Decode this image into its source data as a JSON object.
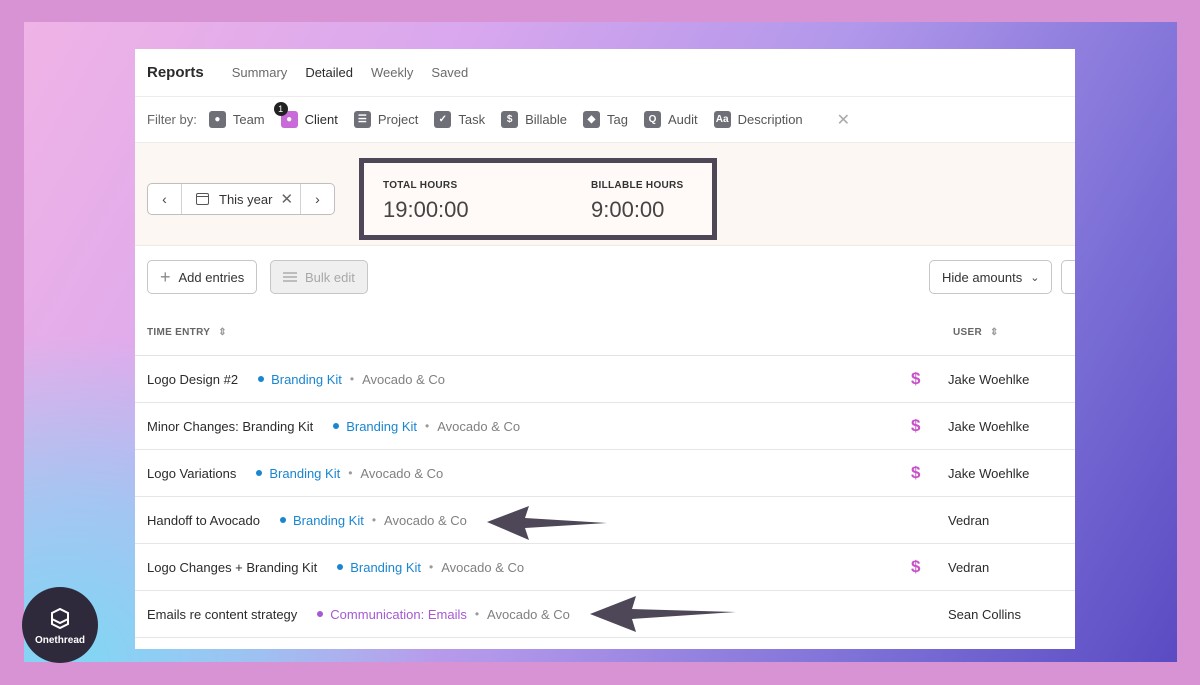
{
  "tabs": {
    "title": "Reports",
    "items": [
      "Summary",
      "Detailed",
      "Weekly",
      "Saved"
    ],
    "active": "Detailed"
  },
  "filters": {
    "label": "Filter by:",
    "items": [
      {
        "label": "Team",
        "icon": "team-icon"
      },
      {
        "label": "Client",
        "icon": "client-icon",
        "badge": "1"
      },
      {
        "label": "Project",
        "icon": "project-icon"
      },
      {
        "label": "Task",
        "icon": "task-icon"
      },
      {
        "label": "Billable",
        "icon": "billable-icon"
      },
      {
        "label": "Tag",
        "icon": "tag-icon"
      },
      {
        "label": "Audit",
        "icon": "audit-icon"
      },
      {
        "label": "Description",
        "icon": "description-icon"
      }
    ]
  },
  "date_picker": {
    "value": "This year"
  },
  "totals": {
    "total_label": "TOTAL HOURS",
    "total_value": "19:00:00",
    "billable_label": "BILLABLE HOURS",
    "billable_value": "9:00:00"
  },
  "toolbar": {
    "add_label": "Add entries",
    "bulk_label": "Bulk edit",
    "hide_label": "Hide amounts"
  },
  "table": {
    "col_entry": "TIME ENTRY",
    "col_user": "USER",
    "rows": [
      {
        "desc": "Logo Design #2",
        "project": "Branding Kit",
        "client": "Avocado & Co",
        "billable": true,
        "user": "Jake Woehlke"
      },
      {
        "desc": "Minor Changes: Branding Kit",
        "project": "Branding Kit",
        "client": "Avocado & Co",
        "billable": true,
        "user": "Jake Woehlke"
      },
      {
        "desc": "Logo Variations",
        "project": "Branding Kit",
        "client": "Avocado & Co",
        "billable": true,
        "user": "Jake Woehlke"
      },
      {
        "desc": "Handoff to Avocado",
        "project": "Branding Kit",
        "client": "Avocado & Co",
        "billable": false,
        "user": "Vedran"
      },
      {
        "desc": "Logo Changes + Branding Kit",
        "project": "Branding Kit",
        "client": "Avocado & Co",
        "billable": true,
        "user": "Vedran"
      },
      {
        "desc": "Emails re content strategy",
        "project": "Communication: Emails",
        "client": "Avocado & Co",
        "billable": false,
        "user": "Sean Collins"
      }
    ]
  },
  "brand": {
    "name": "Onethread"
  },
  "colors": {
    "accent": "#c96ad9",
    "project_blue": "#1a86d0",
    "project_purple": "#a45ad0"
  }
}
